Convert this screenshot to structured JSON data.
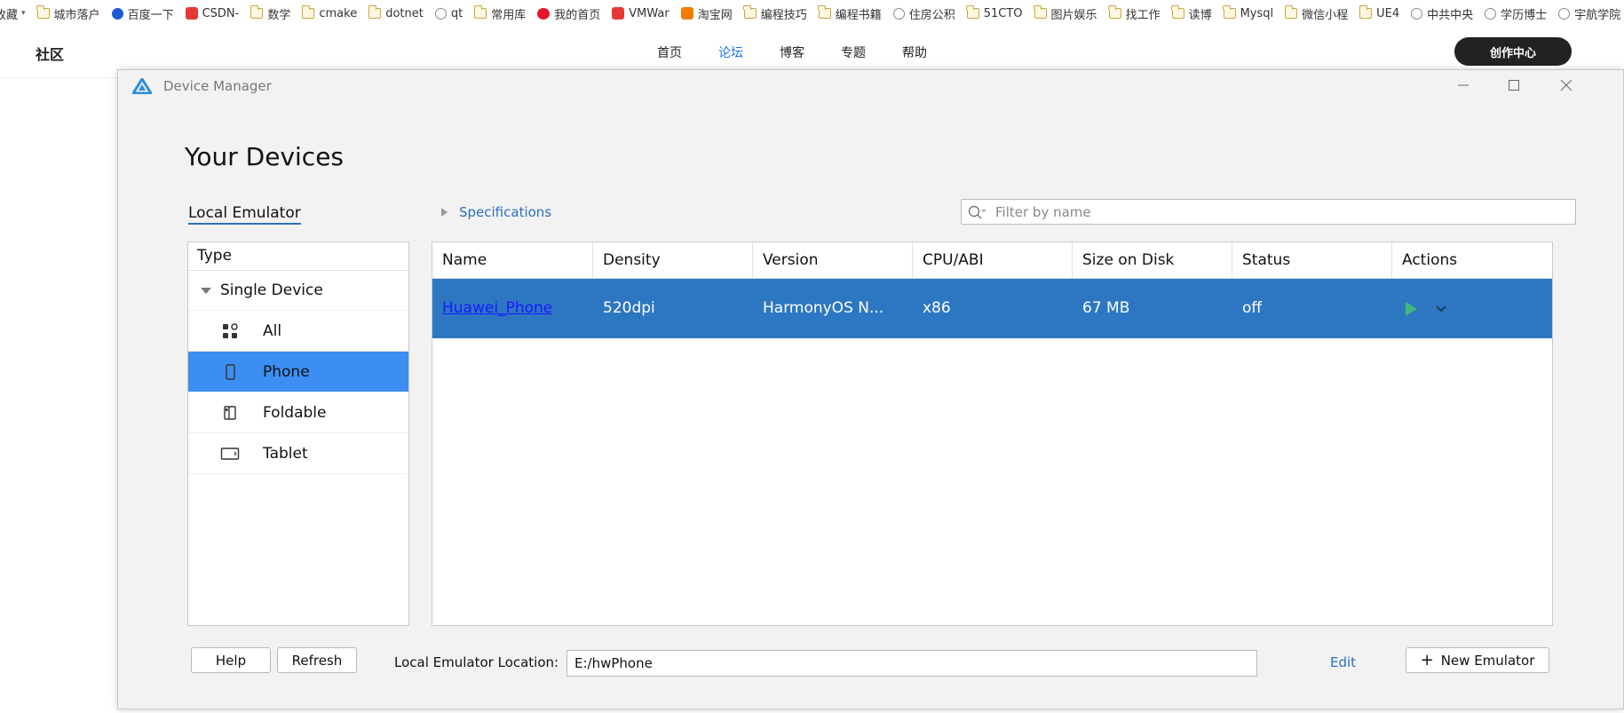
{
  "bookmarks": {
    "items": [
      {
        "label": "收藏",
        "icon": "dropdown"
      },
      {
        "label": "城市落户",
        "icon": "folder-icon"
      },
      {
        "label": "百度一下",
        "icon": "baidu-icon"
      },
      {
        "label": "CSDN-",
        "icon": "csdn-icon"
      },
      {
        "label": "数学",
        "icon": "folder-icon"
      },
      {
        "label": "cmake",
        "icon": "folder-icon"
      },
      {
        "label": "dotnet",
        "icon": "folder-icon"
      },
      {
        "label": "qt",
        "icon": "globe-icon"
      },
      {
        "label": "常用库",
        "icon": "folder-icon"
      },
      {
        "label": "我的首页",
        "icon": "weibo-icon"
      },
      {
        "label": "VMWar",
        "icon": "csdn-icon"
      },
      {
        "label": "淘宝网",
        "icon": "taobao-icon"
      },
      {
        "label": "编程技巧",
        "icon": "folder-icon"
      },
      {
        "label": "编程书籍",
        "icon": "folder-icon"
      },
      {
        "label": "住房公积",
        "icon": "globe-icon"
      },
      {
        "label": "51CTO",
        "icon": "folder-icon"
      },
      {
        "label": "图片娱乐",
        "icon": "folder-icon"
      },
      {
        "label": "找工作",
        "icon": "folder-icon"
      },
      {
        "label": "读博",
        "icon": "folder-icon"
      },
      {
        "label": "Mysql",
        "icon": "folder-icon"
      },
      {
        "label": "微信小程",
        "icon": "folder-icon"
      },
      {
        "label": "UE4",
        "icon": "folder-icon"
      },
      {
        "label": "中共中央",
        "icon": "globe-icon"
      },
      {
        "label": "学历博士",
        "icon": "globe-icon"
      },
      {
        "label": "宇航学院",
        "icon": "globe-icon"
      }
    ],
    "more": "»"
  },
  "site": {
    "logo": "社区",
    "nav": [
      "首页",
      "论坛",
      "博客",
      "专题",
      "帮助"
    ],
    "active_nav": "论坛",
    "create_button": "创作中心"
  },
  "window": {
    "title": "Device Manager",
    "page_title": "Your Devices",
    "tab": "Local Emulator",
    "specifications": "Specifications",
    "filter_placeholder": "Filter by name",
    "type_panel": {
      "header": "Type",
      "group": "Single Device",
      "items": [
        {
          "label": "All",
          "icon": "grid-icon",
          "selected": false
        },
        {
          "label": "Phone",
          "icon": "phone-icon",
          "selected": true
        },
        {
          "label": "Foldable",
          "icon": "foldable-icon",
          "selected": false
        },
        {
          "label": "Tablet",
          "icon": "tablet-icon",
          "selected": false
        }
      ]
    },
    "table": {
      "columns": [
        "Name",
        "Density",
        "Version",
        "CPU/ABI",
        "Size on Disk",
        "Status",
        "Actions"
      ],
      "rows": [
        {
          "name": "Huawei_Phone",
          "density": "520dpi",
          "version": "HarmonyOS N...",
          "cpu": "x86",
          "size": "67 MB",
          "status": "off"
        }
      ]
    },
    "footer": {
      "help": "Help",
      "refresh": "Refresh",
      "location_label": "Local Emulator Location:",
      "location_value": "E:/hwPhone",
      "edit": "Edit",
      "new_emulator": "New Emulator"
    }
  },
  "colors": {
    "selected_row": "#2d77c2",
    "selected_type": "#3d8ef2",
    "link": "#2c6fbf",
    "play": "#3bb87a"
  }
}
